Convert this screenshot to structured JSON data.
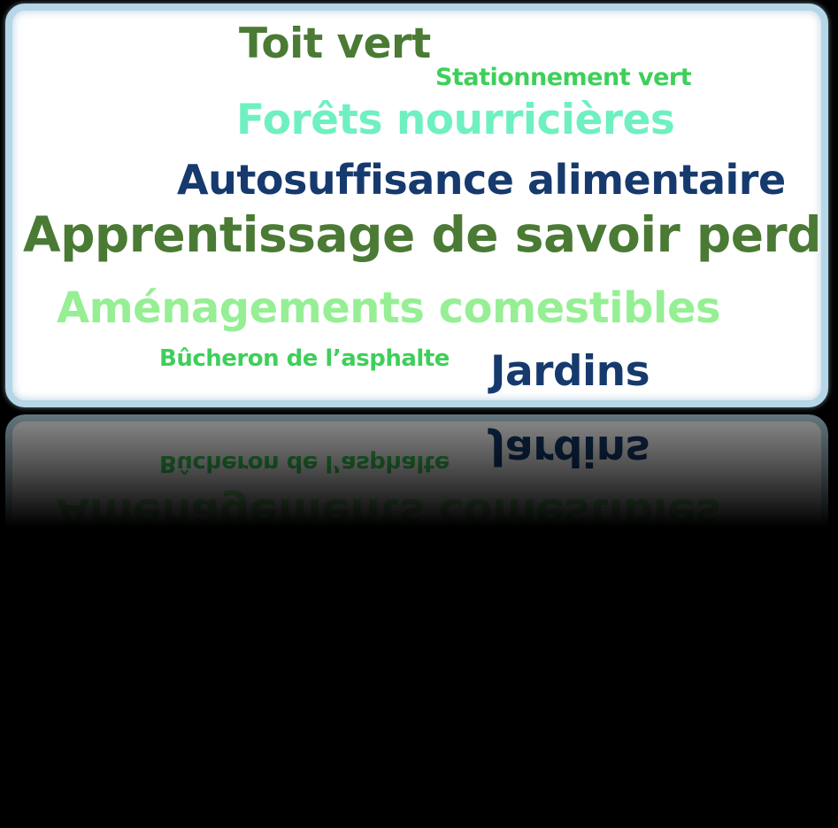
{
  "cloud": {
    "words": [
      {
        "text": "Toit vert",
        "color": "#4a7a34"
      },
      {
        "text": "Stationnement vert",
        "color": "#3ecf5a"
      },
      {
        "text": "Forêts nourricières",
        "color": "#6ff0c0"
      },
      {
        "text": "Autosuffisance alimentaire",
        "color": "#163a6e"
      },
      {
        "text": "Apprentissage de savoir perdu",
        "color": "#4a7a34"
      },
      {
        "text": "Aménagements comestibles",
        "color": "#96ef94"
      },
      {
        "text": "Bûcheron de l’asphalte",
        "color": "#3ecf5a"
      },
      {
        "text": "Jardins",
        "color": "#163a6e"
      }
    ]
  },
  "colors": {
    "background": "#000000",
    "card": "#ffffff",
    "card_border": "#b5d6e6"
  }
}
